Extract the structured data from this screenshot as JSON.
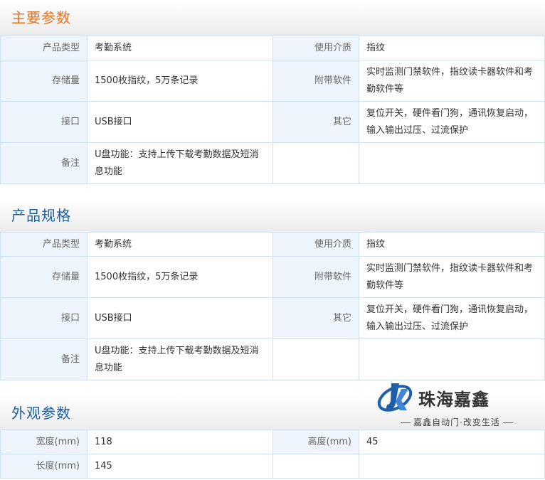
{
  "sections": {
    "main_params": {
      "title": "主要参数",
      "rows": [
        {
          "k1": "产品类型",
          "v1": "考勤系统",
          "k2": "使用介质",
          "v2": "指纹"
        },
        {
          "k1": "存储量",
          "v1": "1500枚指纹，5万条记录",
          "k2": "附带软件",
          "v2": "实时监测门禁软件，指纹读卡器软件和考勤软件等"
        },
        {
          "k1": "接口",
          "v1": "USB接口",
          "k2": "其它",
          "v2": "复位开关，硬件看门狗，通讯恢复启动，输入输出过压、过流保护"
        },
        {
          "k1": "备注",
          "v1": "U盘功能：支持上传下载考勤数据及短消息功能",
          "k2": "",
          "v2": ""
        }
      ]
    },
    "product_spec": {
      "title": "产品规格",
      "rows": [
        {
          "k1": "产品类型",
          "v1": "考勤系统",
          "k2": "使用介质",
          "v2": "指纹"
        },
        {
          "k1": "存储量",
          "v1": "1500枚指纹，5万条记录",
          "k2": "附带软件",
          "v2": "实时监测门禁软件，指纹读卡器软件和考勤软件等"
        },
        {
          "k1": "接口",
          "v1": "USB接口",
          "k2": "其它",
          "v2": "复位开关，硬件看门狗，通讯恢复启动，输入输出过压、过流保护"
        },
        {
          "k1": "备注",
          "v1": "U盘功能：支持上传下载考勤数据及短消息功能",
          "k2": "",
          "v2": ""
        }
      ]
    },
    "appearance": {
      "title": "外观参数",
      "rows": [
        {
          "k1": "宽度(mm)",
          "v1": "118",
          "k2": "高度(mm)",
          "v2": "45"
        },
        {
          "k1": "长度(mm)",
          "v1": "145",
          "k2": "",
          "v2": ""
        }
      ]
    }
  },
  "watermark": {
    "name": "珠海嘉鑫",
    "slogan": "嘉鑫自动门·改变生活"
  },
  "colors": {
    "title_orange": "#e8731f",
    "title_blue": "#1a5f9e",
    "key_cell_bg": "#eef5fc",
    "border": "#cfe0ef",
    "logo_blue": "#1f5fa8"
  }
}
